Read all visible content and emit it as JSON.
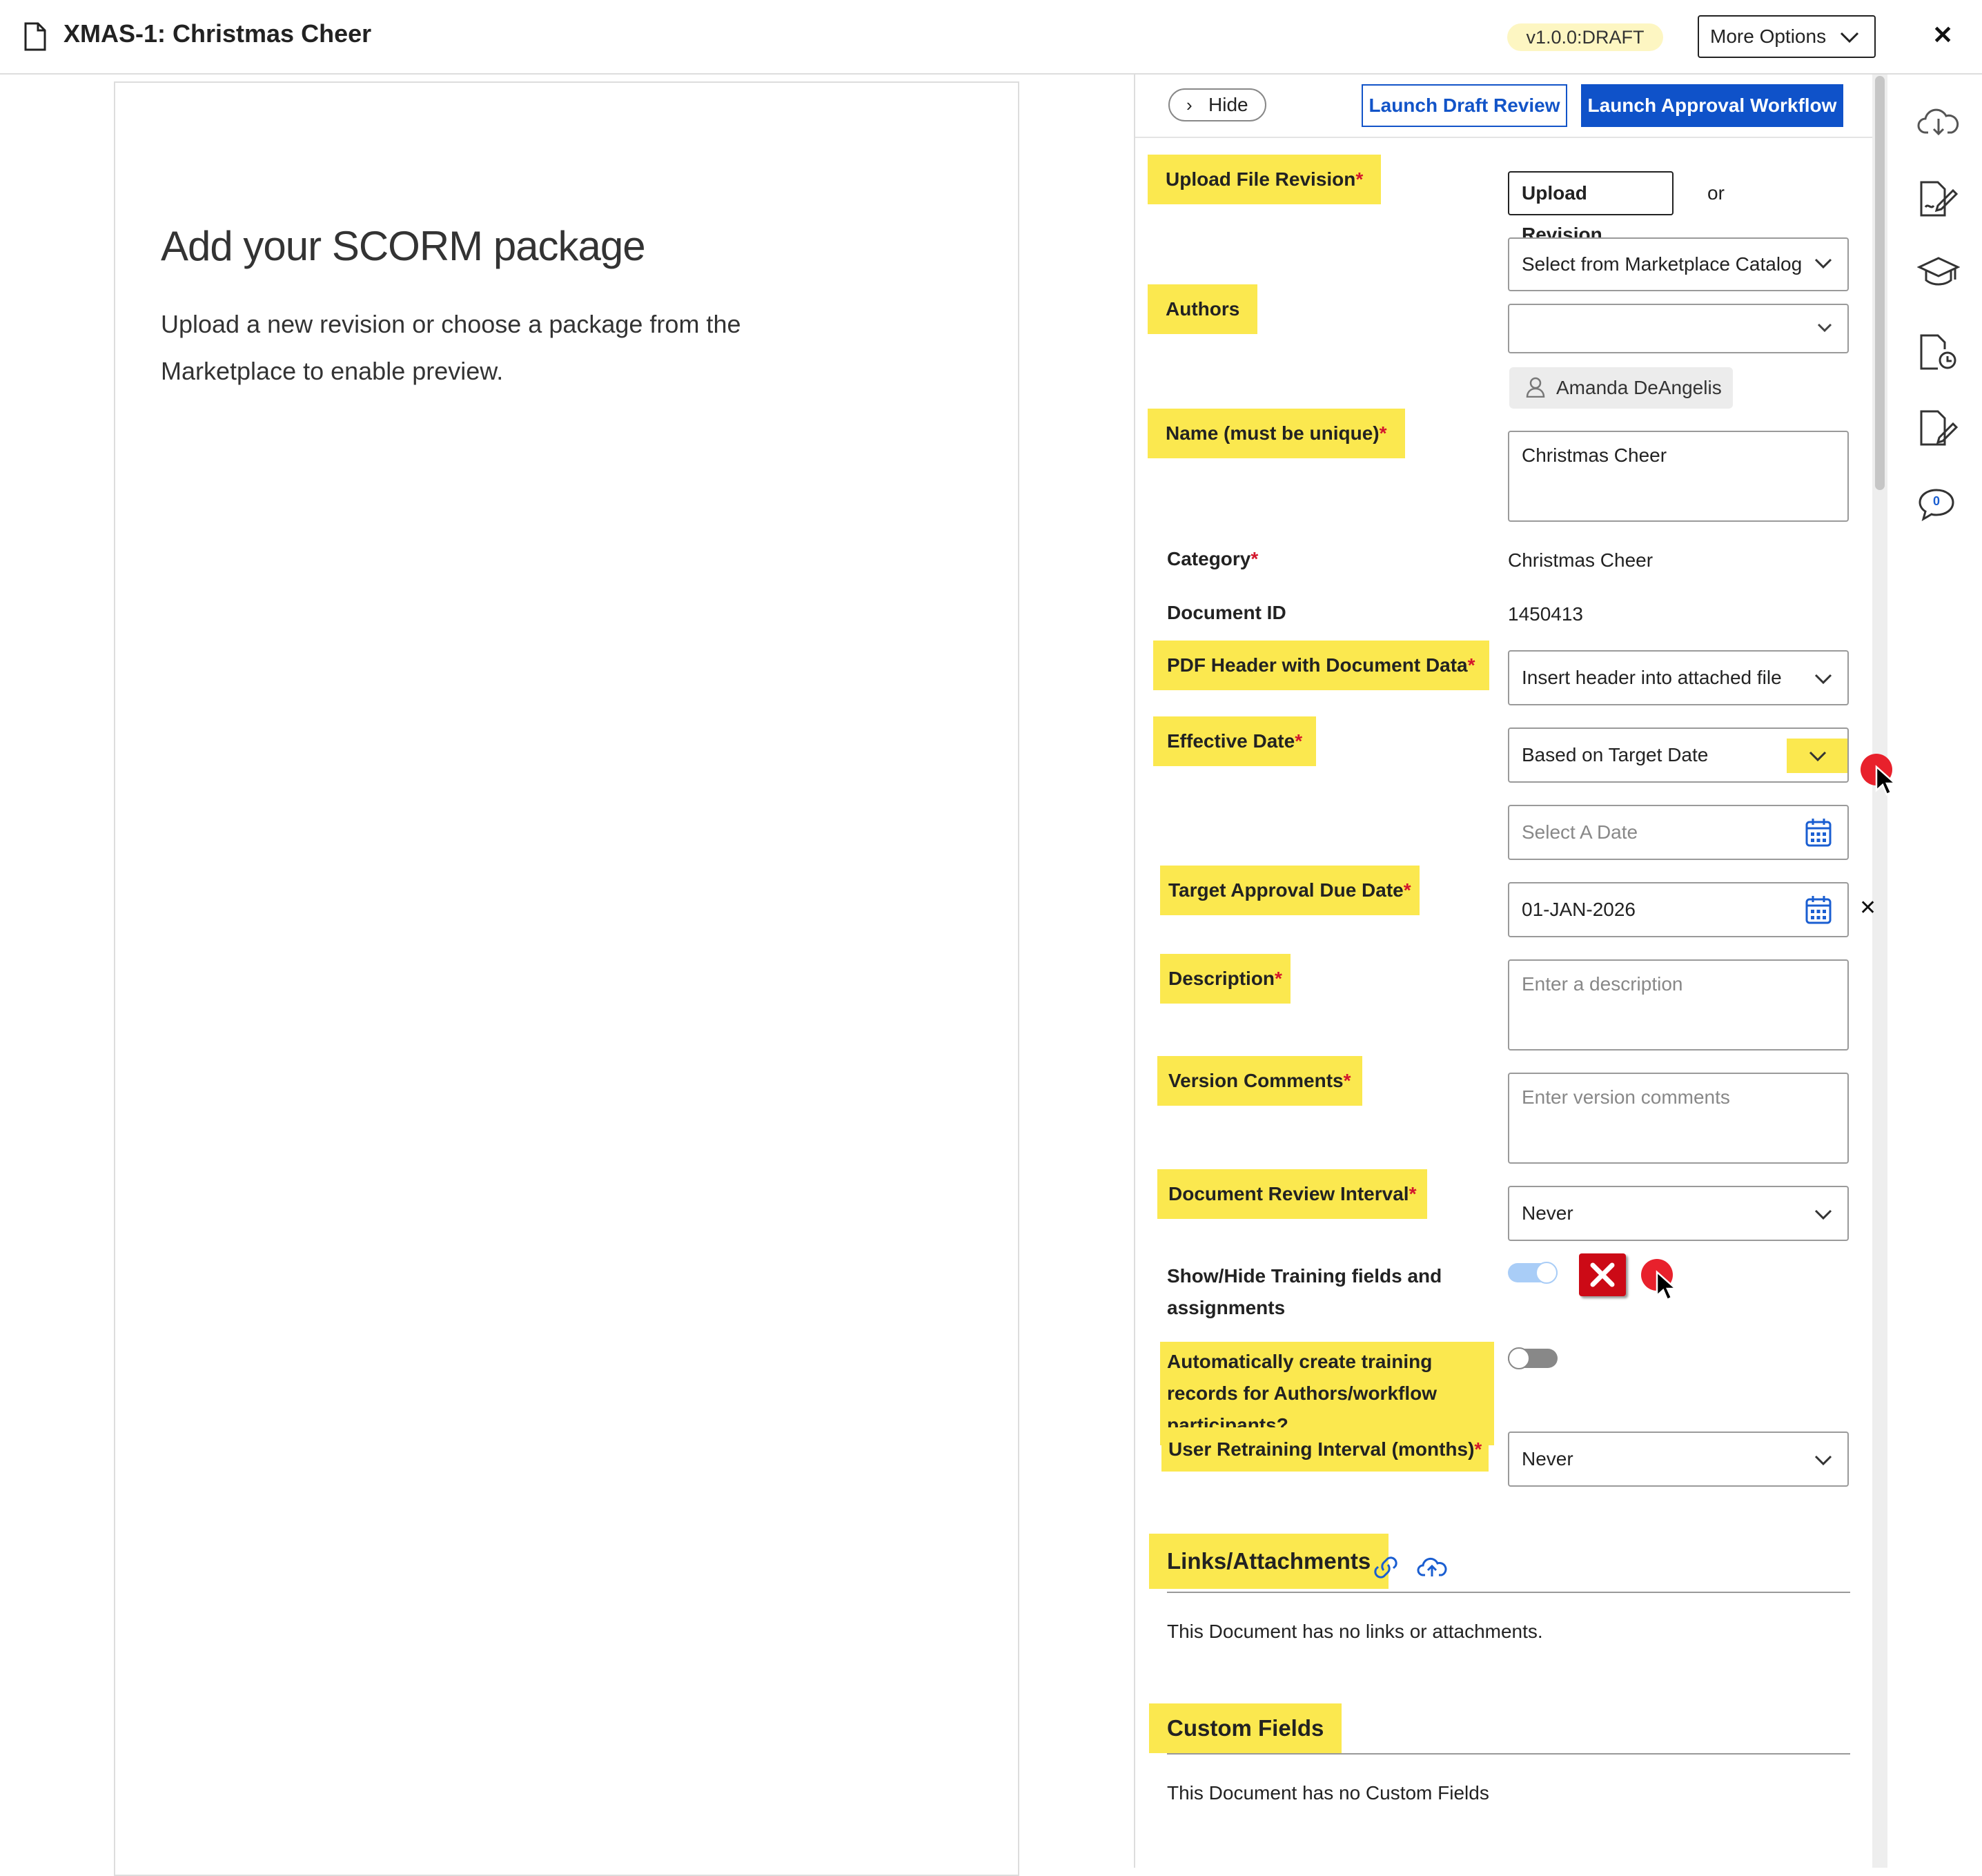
{
  "header": {
    "title": "XMAS-1: Christmas Cheer",
    "version": "v1.0.0:DRAFT",
    "more_options": "More Options"
  },
  "preview": {
    "title": "Add your SCORM package",
    "subtitle": "Upload a new revision or choose a package from the Marketplace to enable preview."
  },
  "panel": {
    "hide_label": "Hide",
    "launch_draft": "Launch Draft Review",
    "launch_approval": "Launch Approval Workflow"
  },
  "form": {
    "upload_label": "Upload File Revision",
    "upload_button": "Upload Revision",
    "or_text": "or",
    "marketplace_select": "Select from Marketplace Catalog",
    "authors_label": "Authors",
    "authors_select": "",
    "author_chip": "Amanda DeAngelis",
    "name_label": "Name (must be unique)",
    "name_value": "Christmas Cheer",
    "category_label": "Category",
    "category_value": "Christmas Cheer",
    "docid_label": "Document ID",
    "docid_value": "1450413",
    "pdf_label": "PDF Header with Document Data",
    "pdf_value": "Insert header into attached file",
    "effective_label": "Effective Date",
    "effective_value": "Based on Target Date",
    "date_placeholder": "Select A Date",
    "target_label": "Target Approval Due Date",
    "target_value": "01-JAN-2026",
    "description_label": "Description",
    "description_placeholder": "Enter a description",
    "version_comments_label": "Version Comments",
    "version_comments_placeholder": "Enter version comments",
    "review_interval_label": "Document Review Interval",
    "review_interval_value": "Never",
    "training_toggle_label": "Show/Hide Training fields and assignments",
    "training_toggle_on": true,
    "auto_create_label": "Automatically create training records for Authors/workflow participants?",
    "auto_create_on": false,
    "retraining_label": "User Retraining Interval (months)",
    "retraining_value": "Never",
    "required_marker": "*"
  },
  "links": {
    "title": "Links/Attachments",
    "empty": "This Document has no links or attachments."
  },
  "custom": {
    "title": "Custom Fields",
    "empty": "This Document has no Custom Fields"
  },
  "sidebar": {
    "comment_count": "0"
  },
  "colors": {
    "highlight": "#fbe84f",
    "primary": "#0f52c9",
    "required": "#d3162c",
    "marker_red": "#e8212c"
  }
}
